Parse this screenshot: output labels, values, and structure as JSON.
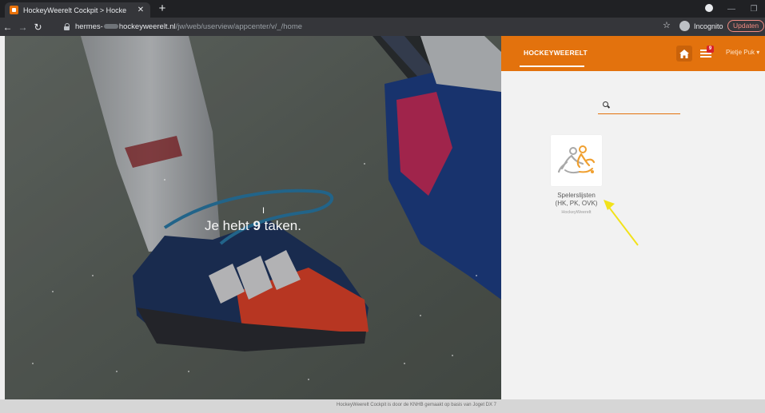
{
  "browser": {
    "tab_title": "HockeyWeerelt Cockpit > Hocke",
    "tab_close": "✕",
    "new_tab": "+",
    "url_prefix": "hermes-",
    "url_domain": "hockeyweerelt.nl",
    "url_path": "/jw/web/userview/appcenter/v/_/home",
    "incognito_label": "Incognito",
    "update_label": "Updaten",
    "icons": [
      "back-arrow-icon",
      "forward-arrow-icon",
      "reload-icon",
      "lock-icon",
      "star-icon",
      "incognito-icon"
    ]
  },
  "header": {
    "brand": "HOCKEYWEERELT",
    "task_count": "9",
    "user_menu": "Pietje Puk ▾",
    "accent_color": "#e3720d",
    "badge_color": "#d8222a"
  },
  "hero": {
    "prefix": "Je hebt ",
    "count": "9",
    "suffix": " taken."
  },
  "search": {
    "value": "",
    "placeholder": ""
  },
  "apps": [
    {
      "name": "Spelerslijsten",
      "subtitle": "(HK, PK, OVK)",
      "publisher": "HockeyWeerelt",
      "icon": "hockey-players-icon"
    }
  ],
  "footer": {
    "text": "HockeyWeerelt Cockpit is door de KNHB gemaakt op basis van Joget DX 7"
  }
}
